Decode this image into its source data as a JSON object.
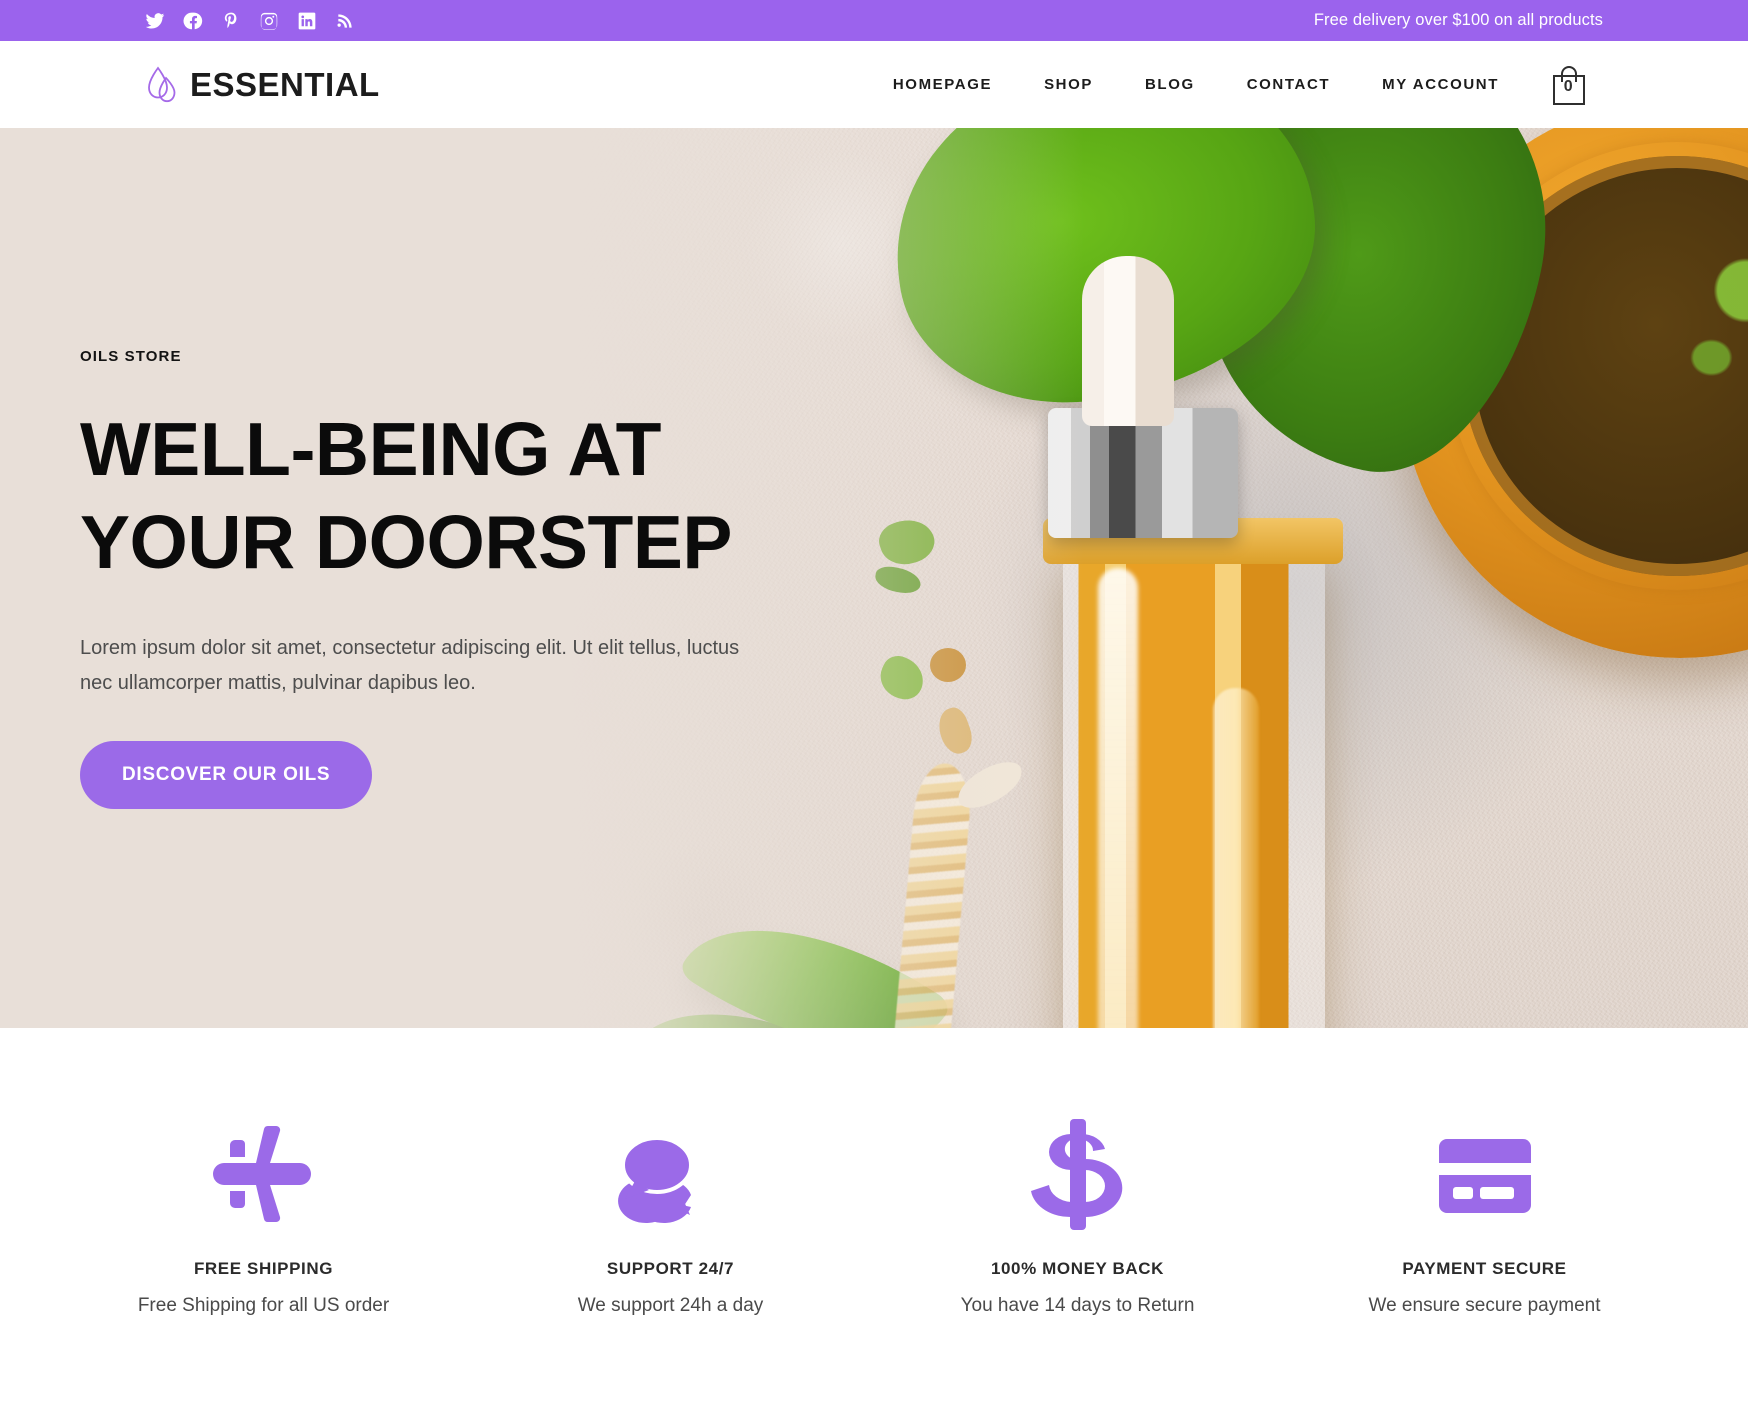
{
  "topbar": {
    "promo": "Free delivery over $100 on all products",
    "background": "#9b63ed",
    "socials": [
      {
        "name": "twitter-icon",
        "label": "Twitter"
      },
      {
        "name": "facebook-icon",
        "label": "Facebook"
      },
      {
        "name": "pinterest-icon",
        "label": "Pinterest"
      },
      {
        "name": "instagram-icon",
        "label": "Instagram"
      },
      {
        "name": "linkedin-icon",
        "label": "LinkedIn"
      },
      {
        "name": "rss-icon",
        "label": "RSS"
      }
    ]
  },
  "header": {
    "brand": "ESSENTIAL",
    "logo_icon": "droplet-icon",
    "nav": [
      {
        "label": "HOMEPAGE"
      },
      {
        "label": "SHOP"
      },
      {
        "label": "BLOG"
      },
      {
        "label": "CONTACT"
      },
      {
        "label": "MY ACCOUNT"
      }
    ],
    "cart": {
      "icon": "shopping-bag-icon",
      "count": "0"
    }
  },
  "hero": {
    "eyebrow": "OILS STORE",
    "title_line1": "WELL-BEING AT",
    "title_line2": "YOUR DOORSTEP",
    "description": "Lorem ipsum dolor sit amet, consectetur adipiscing elit. Ut elit tellus, luctus nec ullamcorper mattis, pulvinar dapibus leo.",
    "cta_label": "DISCOVER OUR OILS",
    "accent_color": "#9b6ae8",
    "background_color": "#e5d9d1",
    "image_alt": "Amber essential oil dropper bottle with green leaves, wheat stalk and a wooden bowl of herbs on textured paper"
  },
  "features": [
    {
      "icon": "airplane-icon",
      "title": "FREE SHIPPING",
      "desc": "Free Shipping for all US order"
    },
    {
      "icon": "chat-bubbles-icon",
      "title": "SUPPORT 24/7",
      "desc": "We support 24h a day"
    },
    {
      "icon": "dollar-sign-icon",
      "title": "100% MONEY BACK",
      "desc": "You have 14 days to Return"
    },
    {
      "icon": "credit-card-icon",
      "title": "PAYMENT SECURE",
      "desc": "We ensure secure payment"
    }
  ],
  "colors": {
    "accent_purple": "#9b63ed",
    "cta_purple": "#9b6ae8",
    "icon_purple": "#9b6ae8",
    "text_dark": "#1c1c1c",
    "hero_beige": "#e5d9d1"
  }
}
